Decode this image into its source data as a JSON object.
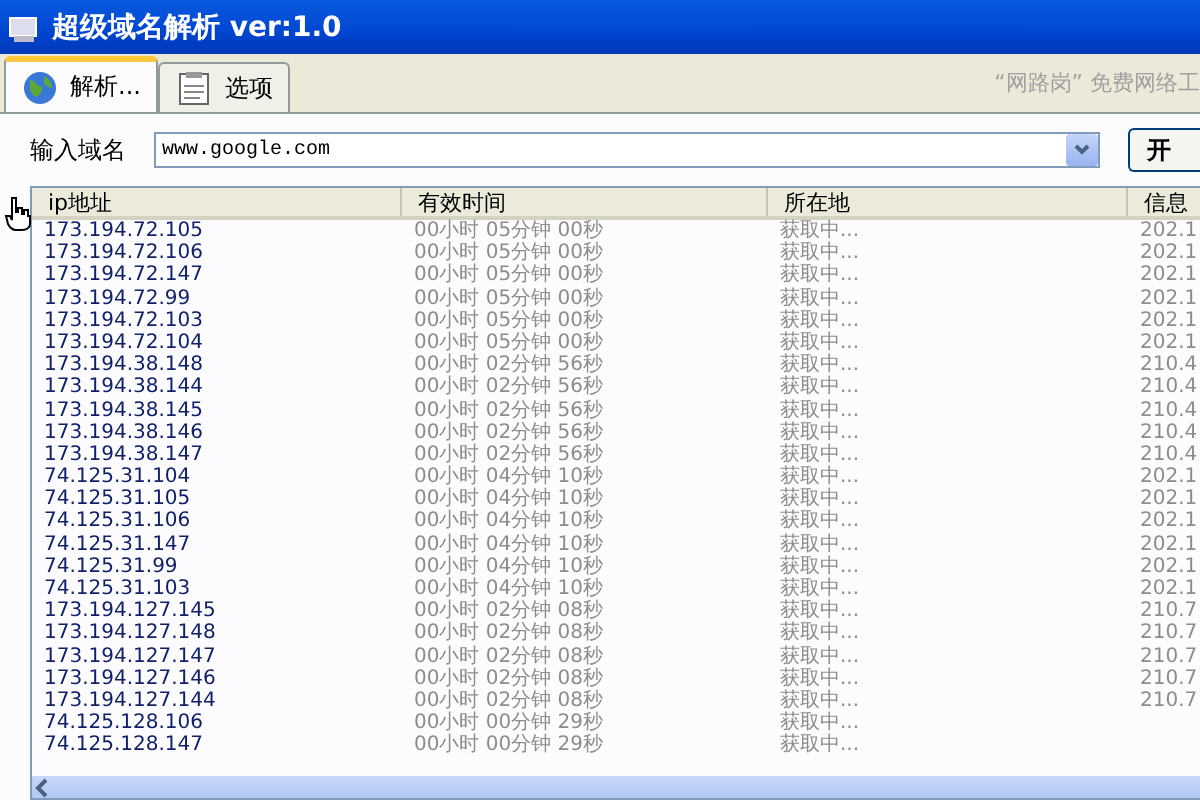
{
  "window": {
    "title": "超级域名解析 ver:1.0"
  },
  "tabs": [
    {
      "label": "解析...",
      "selected": true,
      "kind": "globe"
    },
    {
      "label": "选项",
      "selected": false,
      "kind": "notepad"
    }
  ],
  "banner": "“网路岗” 免费网络工",
  "domain": {
    "label": "输入域名",
    "value": "www.google.com"
  },
  "start_button": "开",
  "table": {
    "columns": [
      "ip地址",
      "有效时间",
      "所在地",
      "信息"
    ],
    "rows": [
      {
        "ip": "173.194.72.105",
        "ttl": "00小时 05分钟 00秒",
        "location": "获取中...",
        "info": "202.1"
      },
      {
        "ip": "173.194.72.106",
        "ttl": "00小时 05分钟 00秒",
        "location": "获取中...",
        "info": "202.1"
      },
      {
        "ip": "173.194.72.147",
        "ttl": "00小时 05分钟 00秒",
        "location": "获取中...",
        "info": "202.1"
      },
      {
        "ip": "173.194.72.99",
        "ttl": "00小时 05分钟 00秒",
        "location": "获取中...",
        "info": "202.1"
      },
      {
        "ip": "173.194.72.103",
        "ttl": "00小时 05分钟 00秒",
        "location": "获取中...",
        "info": "202.1"
      },
      {
        "ip": "173.194.72.104",
        "ttl": "00小时 05分钟 00秒",
        "location": "获取中...",
        "info": "202.1"
      },
      {
        "ip": "173.194.38.148",
        "ttl": "00小时 02分钟 56秒",
        "location": "获取中...",
        "info": "210.4"
      },
      {
        "ip": "173.194.38.144",
        "ttl": "00小时 02分钟 56秒",
        "location": "获取中...",
        "info": "210.4"
      },
      {
        "ip": "173.194.38.145",
        "ttl": "00小时 02分钟 56秒",
        "location": "获取中...",
        "info": "210.4"
      },
      {
        "ip": "173.194.38.146",
        "ttl": "00小时 02分钟 56秒",
        "location": "获取中...",
        "info": "210.4"
      },
      {
        "ip": "173.194.38.147",
        "ttl": "00小时 02分钟 56秒",
        "location": "获取中...",
        "info": "210.4"
      },
      {
        "ip": "74.125.31.104",
        "ttl": "00小时 04分钟 10秒",
        "location": "获取中...",
        "info": "202.1"
      },
      {
        "ip": "74.125.31.105",
        "ttl": "00小时 04分钟 10秒",
        "location": "获取中...",
        "info": "202.1"
      },
      {
        "ip": "74.125.31.106",
        "ttl": "00小时 04分钟 10秒",
        "location": "获取中...",
        "info": "202.1"
      },
      {
        "ip": "74.125.31.147",
        "ttl": "00小时 04分钟 10秒",
        "location": "获取中...",
        "info": "202.1"
      },
      {
        "ip": "74.125.31.99",
        "ttl": "00小时 04分钟 10秒",
        "location": "获取中...",
        "info": "202.1"
      },
      {
        "ip": "74.125.31.103",
        "ttl": "00小时 04分钟 10秒",
        "location": "获取中...",
        "info": "202.1"
      },
      {
        "ip": "173.194.127.145",
        "ttl": "00小时 02分钟 08秒",
        "location": "获取中...",
        "info": "210.7"
      },
      {
        "ip": "173.194.127.148",
        "ttl": "00小时 02分钟 08秒",
        "location": "获取中...",
        "info": "210.7"
      },
      {
        "ip": "173.194.127.147",
        "ttl": "00小时 02分钟 08秒",
        "location": "获取中...",
        "info": "210.7"
      },
      {
        "ip": "173.194.127.146",
        "ttl": "00小时 02分钟 08秒",
        "location": "获取中...",
        "info": "210.7"
      },
      {
        "ip": "173.194.127.144",
        "ttl": "00小时 02分钟 08秒",
        "location": "获取中...",
        "info": "210.7"
      },
      {
        "ip": "74.125.128.106",
        "ttl": "00小时 00分钟 29秒",
        "location": "获取中..."
      },
      {
        "ip": "74.125.128.147",
        "ttl": "00小时 00分钟 29秒",
        "location": "获取中..."
      }
    ]
  }
}
